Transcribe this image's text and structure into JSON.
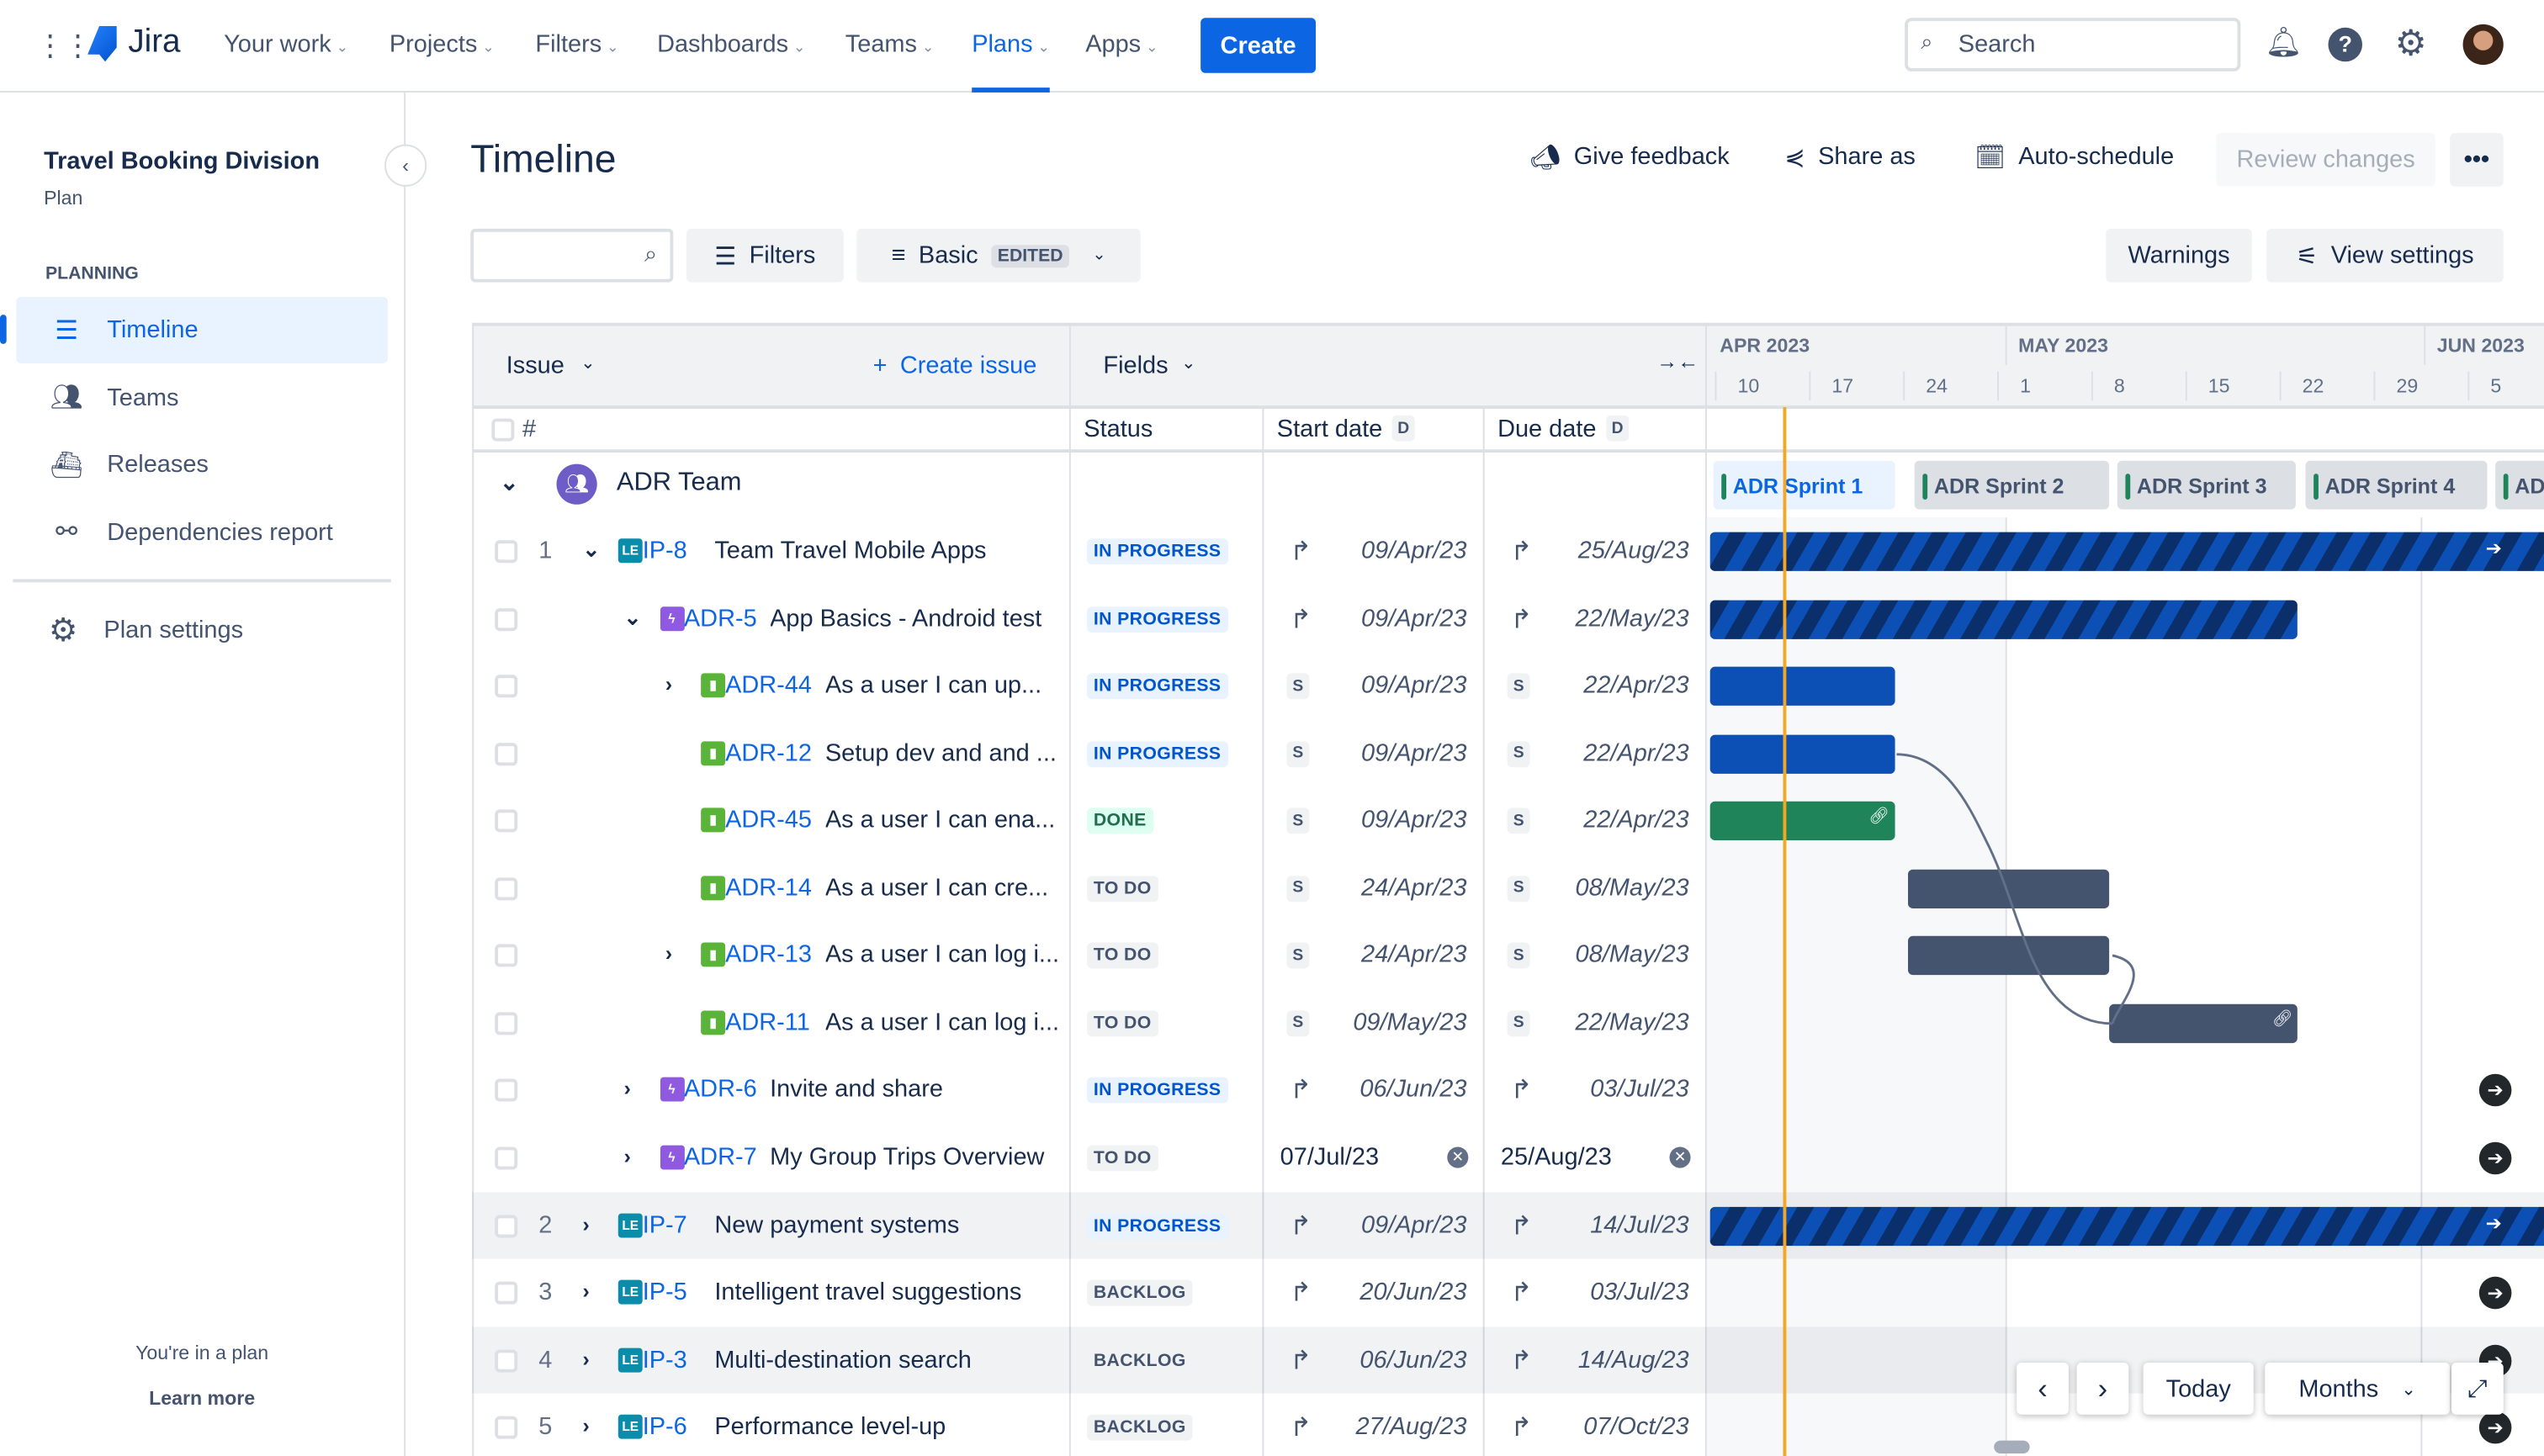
{
  "nav": {
    "product": "Jira",
    "items": [
      {
        "label": "Your work"
      },
      {
        "label": "Projects"
      },
      {
        "label": "Filters"
      },
      {
        "label": "Dashboards"
      },
      {
        "label": "Teams"
      },
      {
        "label": "Plans",
        "active": true
      },
      {
        "label": "Apps"
      }
    ],
    "create": "Create",
    "search_placeholder": "Search"
  },
  "sidebar": {
    "plan_name": "Travel Booking Division",
    "plan_type": "Plan",
    "section": "PLANNING",
    "items": [
      {
        "label": "Timeline",
        "icon": "timeline-icon",
        "active": true
      },
      {
        "label": "Teams",
        "icon": "teams-icon"
      },
      {
        "label": "Releases",
        "icon": "ship-icon"
      },
      {
        "label": "Dependencies report",
        "icon": "dependencies-icon"
      }
    ],
    "settings": "Plan settings",
    "footer_text": "You're in a plan",
    "learn_more": "Learn more"
  },
  "header": {
    "title": "Timeline",
    "give_feedback": "Give feedback",
    "share_as": "Share as",
    "auto_schedule": "Auto-schedule",
    "review_changes": "Review changes"
  },
  "toolbar": {
    "search_value": "",
    "filters": "Filters",
    "view": "Basic",
    "view_badge": "EDITED",
    "warnings": "Warnings",
    "view_settings": "View settings"
  },
  "table": {
    "issue_header": "Issue",
    "create_issue": "Create issue",
    "fields": "Fields",
    "hash": "#",
    "status": "Status",
    "start_date": "Start date",
    "due_date": "Due date",
    "date_badge": "D",
    "team": "ADR Team"
  },
  "timeline": {
    "months": [
      {
        "label": "APR 2023"
      },
      {
        "label": "MAY 2023"
      },
      {
        "label": "JUN 2023"
      }
    ],
    "weeks": [
      "10",
      "17",
      "24",
      "1",
      "8",
      "15",
      "22",
      "29",
      "5"
    ],
    "sprints": [
      "ADR Sprint 1",
      "ADR Sprint 2",
      "ADR Sprint 3",
      "ADR Sprint 4",
      "AD"
    ],
    "today": "15/Apr/23"
  },
  "colors": {
    "accent": "#0c66e4",
    "today": "#f5a623",
    "done": "#1f845a",
    "todo": "#44546f",
    "inprogress": "#0c4fb5"
  },
  "rows": [
    {
      "num": "1",
      "exp": "down",
      "lvl": 0,
      "type": "LE",
      "key": "IP-8",
      "summary": "Team Travel Mobile Apps",
      "status": "IN PROGRESS",
      "start": "09/Apr/23",
      "smode": "rollup",
      "due": "25/Aug/23",
      "dmode": "rollup"
    },
    {
      "num": "",
      "exp": "down",
      "lvl": 1,
      "type": "epic",
      "key": "ADR-5",
      "summary": "App Basics - Android test",
      "status": "IN PROGRESS",
      "start": "09/Apr/23",
      "smode": "rollup",
      "due": "22/May/23",
      "dmode": "rollup"
    },
    {
      "num": "",
      "exp": "right",
      "lvl": 2,
      "type": "story",
      "key": "ADR-44",
      "summary": "As a user I can up...",
      "status": "IN PROGRESS",
      "start": "09/Apr/23",
      "smode": "sprint",
      "due": "22/Apr/23",
      "dmode": "sprint"
    },
    {
      "num": "",
      "exp": "",
      "lvl": 2,
      "type": "story",
      "key": "ADR-12",
      "summary": "Setup dev and and ...",
      "status": "IN PROGRESS",
      "start": "09/Apr/23",
      "smode": "sprint",
      "due": "22/Apr/23",
      "dmode": "sprint"
    },
    {
      "num": "",
      "exp": "",
      "lvl": 2,
      "type": "story",
      "key": "ADR-45",
      "summary": "As a user I can ena...",
      "status": "DONE",
      "start": "09/Apr/23",
      "smode": "sprint",
      "due": "22/Apr/23",
      "dmode": "sprint"
    },
    {
      "num": "",
      "exp": "",
      "lvl": 2,
      "type": "story",
      "key": "ADR-14",
      "summary": "As a user I can cre...",
      "status": "TO DO",
      "start": "24/Apr/23",
      "smode": "sprint",
      "due": "08/May/23",
      "dmode": "sprint"
    },
    {
      "num": "",
      "exp": "right",
      "lvl": 2,
      "type": "story",
      "key": "ADR-13",
      "summary": "As a user I can log i...",
      "status": "TO DO",
      "start": "24/Apr/23",
      "smode": "sprint",
      "due": "08/May/23",
      "dmode": "sprint"
    },
    {
      "num": "",
      "exp": "",
      "lvl": 2,
      "type": "story",
      "key": "ADR-11",
      "summary": "As a user I can log i...",
      "status": "TO DO",
      "start": "09/May/23",
      "smode": "sprint",
      "due": "22/May/23",
      "dmode": "sprint"
    },
    {
      "num": "",
      "exp": "right",
      "lvl": 1,
      "type": "epic",
      "key": "ADR-6",
      "summary": "Invite and share",
      "status": "IN PROGRESS",
      "start": "06/Jun/23",
      "smode": "rollup",
      "due": "03/Jul/23",
      "dmode": "rollup"
    },
    {
      "num": "",
      "exp": "right",
      "lvl": 1,
      "type": "epic",
      "key": "ADR-7",
      "summary": "My Group Trips Overview",
      "status": "TO DO",
      "start": "07/Jul/23",
      "smode": "fixed",
      "due": "25/Aug/23",
      "dmode": "fixed"
    },
    {
      "num": "2",
      "exp": "right",
      "lvl": 0,
      "type": "LE",
      "key": "IP-7",
      "summary": "New payment systems",
      "status": "IN PROGRESS",
      "start": "09/Apr/23",
      "smode": "rollup",
      "due": "14/Jul/23",
      "dmode": "rollup",
      "hl": true
    },
    {
      "num": "3",
      "exp": "right",
      "lvl": 0,
      "type": "LE",
      "key": "IP-5",
      "summary": "Intelligent travel suggestions",
      "status": "BACKLOG",
      "start": "20/Jun/23",
      "smode": "rollup",
      "due": "03/Jul/23",
      "dmode": "rollup"
    },
    {
      "num": "4",
      "exp": "right",
      "lvl": 0,
      "type": "LE",
      "key": "IP-3",
      "summary": "Multi-destination search",
      "status": "BACKLOG",
      "start": "06/Jun/23",
      "smode": "rollup",
      "due": "14/Aug/23",
      "dmode": "rollup",
      "hl": true
    },
    {
      "num": "5",
      "exp": "right",
      "lvl": 0,
      "type": "LE",
      "key": "IP-6",
      "summary": "Performance level-up",
      "status": "BACKLOG",
      "start": "27/Aug/23",
      "smode": "rollup",
      "due": "07/Oct/23",
      "dmode": "rollup"
    }
  ],
  "controls": {
    "today": "Today",
    "scale": "Months"
  }
}
